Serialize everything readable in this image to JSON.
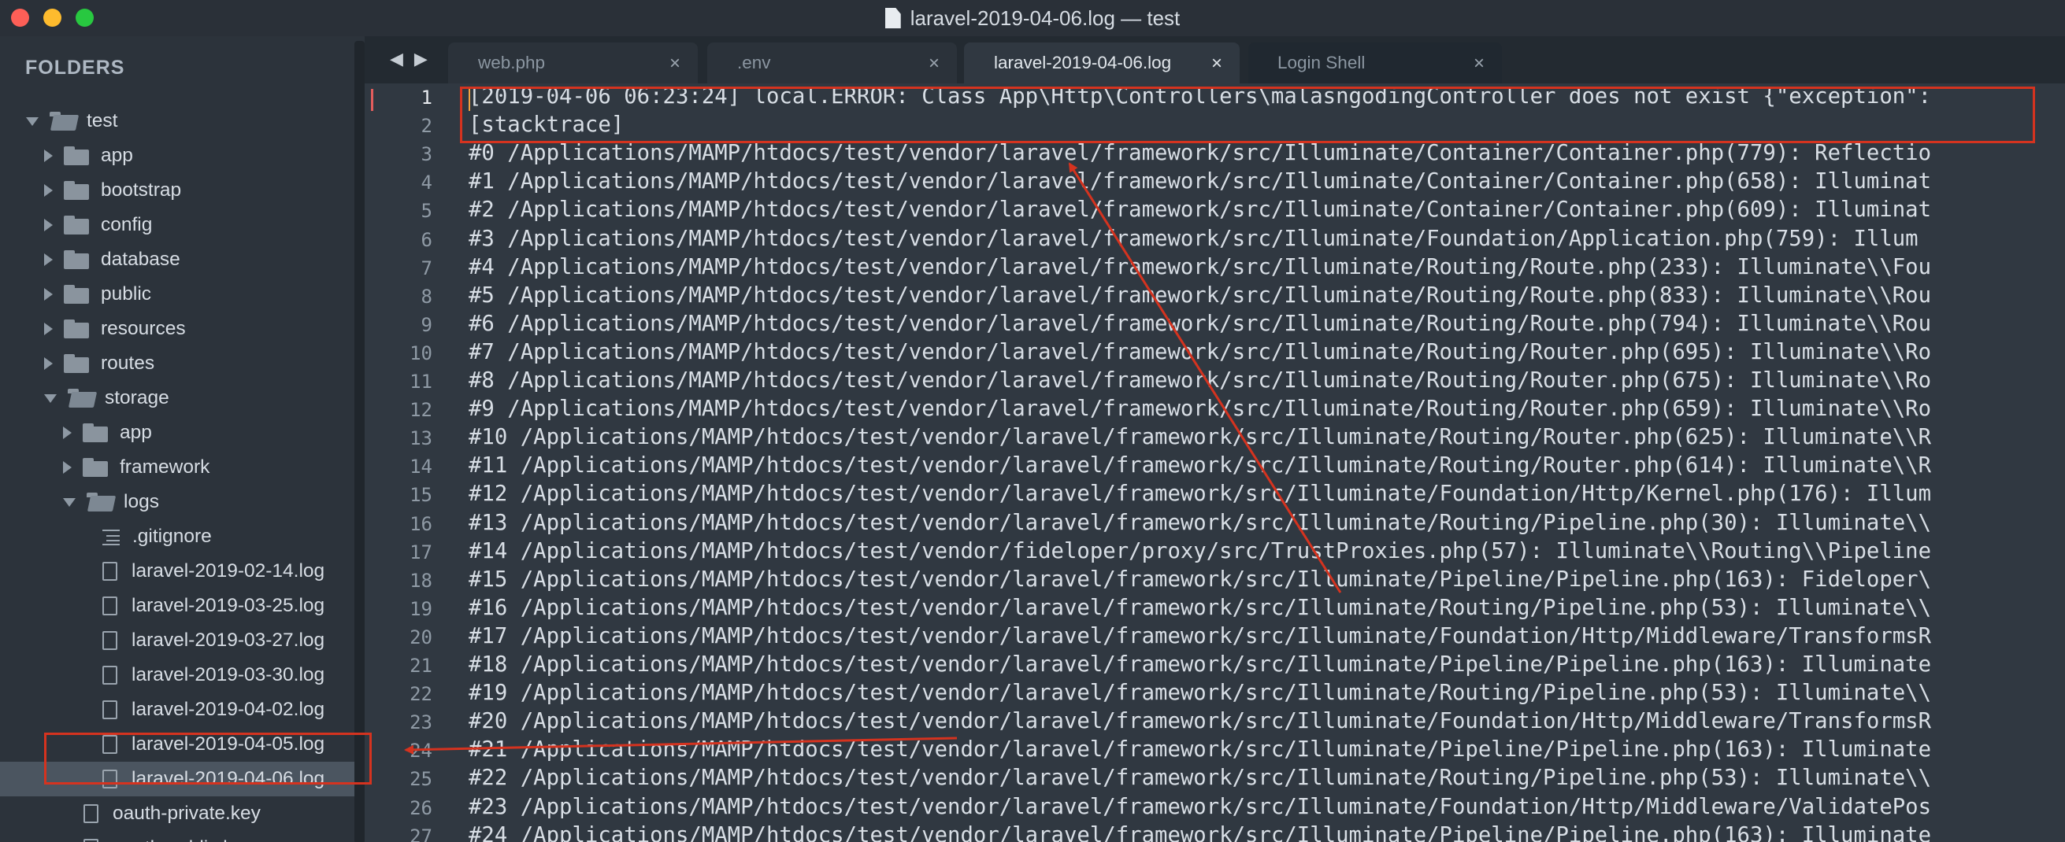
{
  "window": {
    "title": "laravel-2019-04-06.log — test",
    "traffic_lights": [
      "#fd5f57",
      "#febb2e",
      "#28c840"
    ]
  },
  "sidebar": {
    "heading": "FOLDERS",
    "items": [
      {
        "label": "test",
        "kind": "folder",
        "state": "open",
        "depth": 0
      },
      {
        "label": "app",
        "kind": "folder",
        "state": "closed",
        "depth": 1
      },
      {
        "label": "bootstrap",
        "kind": "folder",
        "state": "closed",
        "depth": 1
      },
      {
        "label": "config",
        "kind": "folder",
        "state": "closed",
        "depth": 1
      },
      {
        "label": "database",
        "kind": "folder",
        "state": "closed",
        "depth": 1
      },
      {
        "label": "public",
        "kind": "folder",
        "state": "closed",
        "depth": 1
      },
      {
        "label": "resources",
        "kind": "folder",
        "state": "closed",
        "depth": 1
      },
      {
        "label": "routes",
        "kind": "folder",
        "state": "closed",
        "depth": 1
      },
      {
        "label": "storage",
        "kind": "folder",
        "state": "open",
        "depth": 1
      },
      {
        "label": "app",
        "kind": "folder",
        "state": "closed",
        "depth": 2
      },
      {
        "label": "framework",
        "kind": "folder",
        "state": "closed",
        "depth": 2
      },
      {
        "label": "logs",
        "kind": "folder",
        "state": "open",
        "depth": 2
      },
      {
        "label": ".gitignore",
        "kind": "textfile",
        "depth": 3
      },
      {
        "label": "laravel-2019-02-14.log",
        "kind": "file",
        "depth": 3
      },
      {
        "label": "laravel-2019-03-25.log",
        "kind": "file",
        "depth": 3
      },
      {
        "label": "laravel-2019-03-27.log",
        "kind": "file",
        "depth": 3
      },
      {
        "label": "laravel-2019-03-30.log",
        "kind": "file",
        "depth": 3
      },
      {
        "label": "laravel-2019-04-02.log",
        "kind": "file",
        "depth": 3
      },
      {
        "label": "laravel-2019-04-05.log",
        "kind": "file",
        "depth": 3
      },
      {
        "label": "laravel-2019-04-06.log",
        "kind": "file",
        "depth": 3,
        "selected": true
      },
      {
        "label": "oauth-private.key",
        "kind": "file",
        "depth": 2
      },
      {
        "label": "oauth-public.key",
        "kind": "file",
        "depth": 2
      }
    ]
  },
  "tabs": [
    {
      "label": "web.php",
      "close": "×",
      "state": "inactive"
    },
    {
      "label": ".env",
      "close": "×",
      "state": "inactive"
    },
    {
      "label": "laravel-2019-04-06.log",
      "close": "×",
      "state": "active"
    },
    {
      "label": "Login Shell",
      "close": "×",
      "state": "terminal"
    }
  ],
  "nav": {
    "back": "◀",
    "forward": "▶"
  },
  "editor": {
    "current_line": 1,
    "lines": [
      {
        "n": "1",
        "text": "[2019-04-06 06:23:24] local.ERROR: Class App\\Http\\Controllers\\malasngodingController does not exist {\"exception\":"
      },
      {
        "n": "2",
        "text": "[stacktrace]"
      },
      {
        "n": "3",
        "text": "#0 /Applications/MAMP/htdocs/test/vendor/laravel/framework/src/Illuminate/Container/Container.php(779): Reflectio"
      },
      {
        "n": "4",
        "text": "#1 /Applications/MAMP/htdocs/test/vendor/laravel/framework/src/Illuminate/Container/Container.php(658): Illuminat"
      },
      {
        "n": "5",
        "text": "#2 /Applications/MAMP/htdocs/test/vendor/laravel/framework/src/Illuminate/Container/Container.php(609): Illuminat"
      },
      {
        "n": "6",
        "text": "#3 /Applications/MAMP/htdocs/test/vendor/laravel/framework/src/Illuminate/Foundation/Application.php(759): Illum"
      },
      {
        "n": "7",
        "text": "#4 /Applications/MAMP/htdocs/test/vendor/laravel/framework/src/Illuminate/Routing/Route.php(233): Illuminate\\\\Fou"
      },
      {
        "n": "8",
        "text": "#5 /Applications/MAMP/htdocs/test/vendor/laravel/framework/src/Illuminate/Routing/Route.php(833): Illuminate\\\\Rou"
      },
      {
        "n": "9",
        "text": "#6 /Applications/MAMP/htdocs/test/vendor/laravel/framework/src/Illuminate/Routing/Route.php(794): Illuminate\\\\Rou"
      },
      {
        "n": "10",
        "text": "#7 /Applications/MAMP/htdocs/test/vendor/laravel/framework/src/Illuminate/Routing/Router.php(695): Illuminate\\\\Ro"
      },
      {
        "n": "11",
        "text": "#8 /Applications/MAMP/htdocs/test/vendor/laravel/framework/src/Illuminate/Routing/Router.php(675): Illuminate\\\\Ro"
      },
      {
        "n": "12",
        "text": "#9 /Applications/MAMP/htdocs/test/vendor/laravel/framework/src/Illuminate/Routing/Router.php(659): Illuminate\\\\Ro"
      },
      {
        "n": "13",
        "text": "#10 /Applications/MAMP/htdocs/test/vendor/laravel/framework/src/Illuminate/Routing/Router.php(625): Illuminate\\\\R"
      },
      {
        "n": "14",
        "text": "#11 /Applications/MAMP/htdocs/test/vendor/laravel/framework/src/Illuminate/Routing/Router.php(614): Illuminate\\\\R"
      },
      {
        "n": "15",
        "text": "#12 /Applications/MAMP/htdocs/test/vendor/laravel/framework/src/Illuminate/Foundation/Http/Kernel.php(176): Illum"
      },
      {
        "n": "16",
        "text": "#13 /Applications/MAMP/htdocs/test/vendor/laravel/framework/src/Illuminate/Routing/Pipeline.php(30): Illuminate\\\\"
      },
      {
        "n": "17",
        "text": "#14 /Applications/MAMP/htdocs/test/vendor/fideloper/proxy/src/TrustProxies.php(57): Illuminate\\\\Routing\\\\Pipeline"
      },
      {
        "n": "18",
        "text": "#15 /Applications/MAMP/htdocs/test/vendor/laravel/framework/src/Illuminate/Pipeline/Pipeline.php(163): Fideloper\\"
      },
      {
        "n": "19",
        "text": "#16 /Applications/MAMP/htdocs/test/vendor/laravel/framework/src/Illuminate/Routing/Pipeline.php(53): Illuminate\\\\"
      },
      {
        "n": "20",
        "text": "#17 /Applications/MAMP/htdocs/test/vendor/laravel/framework/src/Illuminate/Foundation/Http/Middleware/TransformsR"
      },
      {
        "n": "21",
        "text": "#18 /Applications/MAMP/htdocs/test/vendor/laravel/framework/src/Illuminate/Pipeline/Pipeline.php(163): Illuminate"
      },
      {
        "n": "22",
        "text": "#19 /Applications/MAMP/htdocs/test/vendor/laravel/framework/src/Illuminate/Routing/Pipeline.php(53): Illuminate\\\\"
      },
      {
        "n": "23",
        "text": "#20 /Applications/MAMP/htdocs/test/vendor/laravel/framework/src/Illuminate/Foundation/Http/Middleware/TransformsR"
      },
      {
        "n": "24",
        "text": "#21 /Applications/MAMP/htdocs/test/vendor/laravel/framework/src/Illuminate/Pipeline/Pipeline.php(163): Illuminate"
      },
      {
        "n": "25",
        "text": "#22 /Applications/MAMP/htdocs/test/vendor/laravel/framework/src/Illuminate/Routing/Pipeline.php(53): Illuminate\\\\"
      },
      {
        "n": "26",
        "text": "#23 /Applications/MAMP/htdocs/test/vendor/laravel/framework/src/Illuminate/Foundation/Http/Middleware/ValidatePos"
      },
      {
        "n": "27",
        "text": "#24 /Applications/MAMP/htdocs/test/vendor/laravel/framework/src/Illuminate/Pipeline/Pipeline.php(163): Illuminate"
      }
    ]
  },
  "annotation_color": "#d5331f"
}
